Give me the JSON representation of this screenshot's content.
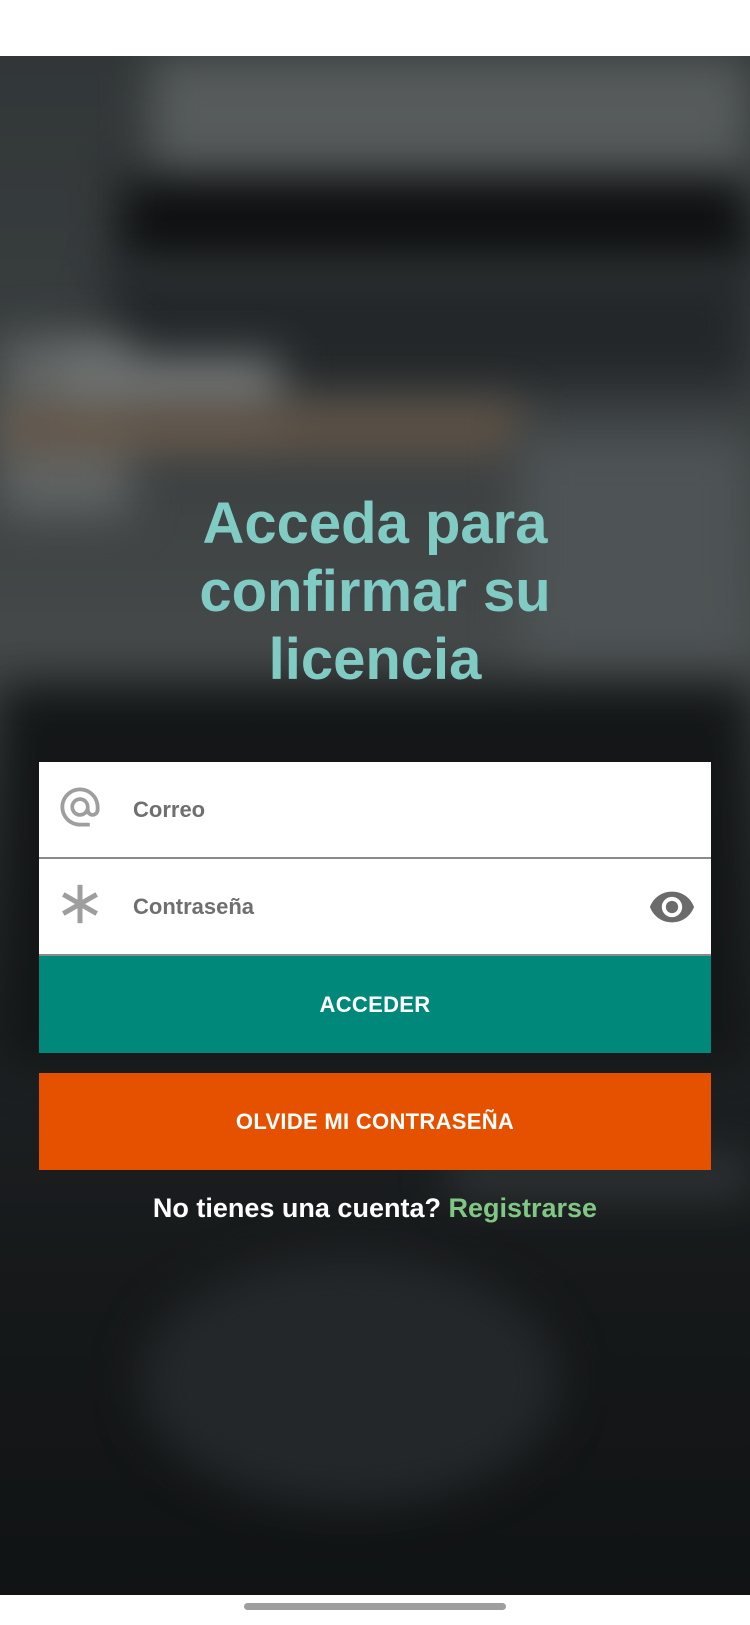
{
  "app": {
    "title_line1": "Acceda para",
    "title_line2": "confirmar su",
    "title_line3": "licencia"
  },
  "login_form": {
    "email": {
      "placeholder": "Correo",
      "value": "",
      "icon": "at-icon"
    },
    "password": {
      "placeholder": "Contraseña",
      "value": "",
      "icon": "asterisk-icon",
      "toggle_icon": "eye-icon"
    },
    "submit_label": "ACCEDER",
    "forgot_label": "OLVIDE MI CONTRASEÑA"
  },
  "signup": {
    "prompt": "No tienes una cuenta?",
    "link": "Registrarse"
  },
  "colors": {
    "title": "#80cbc4",
    "primary_button": "#00897b",
    "secondary_button": "#e65100",
    "link": "#81c784"
  }
}
